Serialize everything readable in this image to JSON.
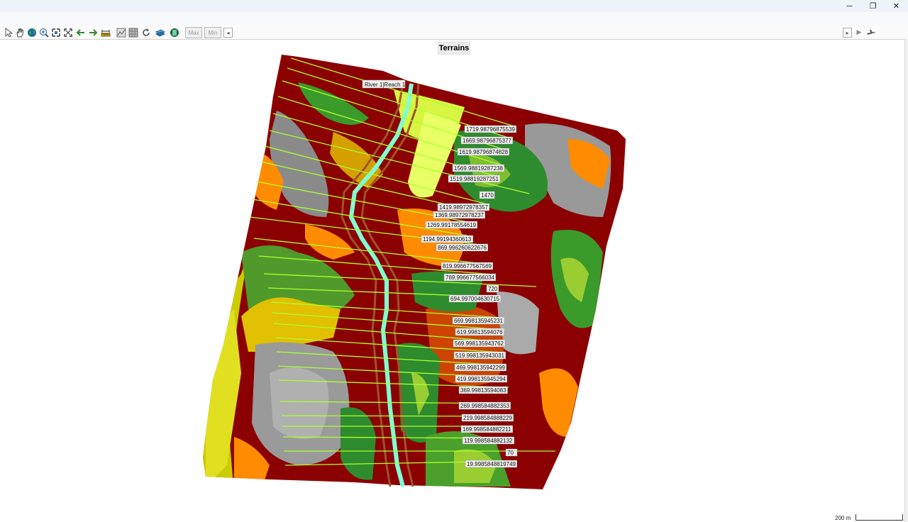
{
  "window": {
    "minimize": "─",
    "restore": "❐",
    "close": "✕"
  },
  "toolbar": {
    "tools": [
      {
        "name": "pointer-tool-icon"
      },
      {
        "name": "pan-hand-icon"
      },
      {
        "name": "globe-icon"
      },
      {
        "name": "zoom-in-icon"
      },
      {
        "name": "zoom-extents-icon"
      },
      {
        "name": "full-extent-icon"
      },
      {
        "name": "back-arrow-icon"
      },
      {
        "name": "forward-arrow-icon"
      },
      {
        "name": "measure-ruler-icon"
      },
      {
        "name": "profile-plot-icon"
      },
      {
        "name": "layers-grid-icon"
      },
      {
        "name": "refresh-icon"
      },
      {
        "name": "map-layers-icon"
      },
      {
        "name": "save-map-icon"
      }
    ],
    "max_label": "Max",
    "min_label": "Min",
    "left_scroll": "◂",
    "right_scroll": "▸",
    "play": "▶",
    "right_icon": "plane-icon"
  },
  "map": {
    "title": "Terrains",
    "river_label": "River 1|Reach 1",
    "stations": [
      "1719.98796875539",
      "1669.98796875377",
      "1619.98796874828",
      "1569.98819287238",
      "1519.98819287251",
      "1470",
      "1419.98972978357",
      "1369.98972978237",
      "1269.99178554619",
      "1194.99194360613",
      "869.996260622676",
      "819.996677567569",
      "769.996677566034",
      "720",
      "694.997004630715",
      "669.998135945231",
      "619.99813594076",
      "569.998135943762",
      "519.998135943031",
      "469.998135942299",
      "419.998135945294",
      "369.99813594083",
      "269.998584882353",
      "219.998584888229",
      "169.998584882211",
      "119.998584882132",
      "70",
      "19.9985848819749"
    ],
    "colors": {
      "river": "#7fffd4",
      "cross_section": "#adff2f",
      "bank": "#a0522d",
      "high": "#8b0000",
      "mid": "#ff8c00",
      "low": "#2e8b57"
    }
  },
  "scale": {
    "label": "200 m"
  }
}
